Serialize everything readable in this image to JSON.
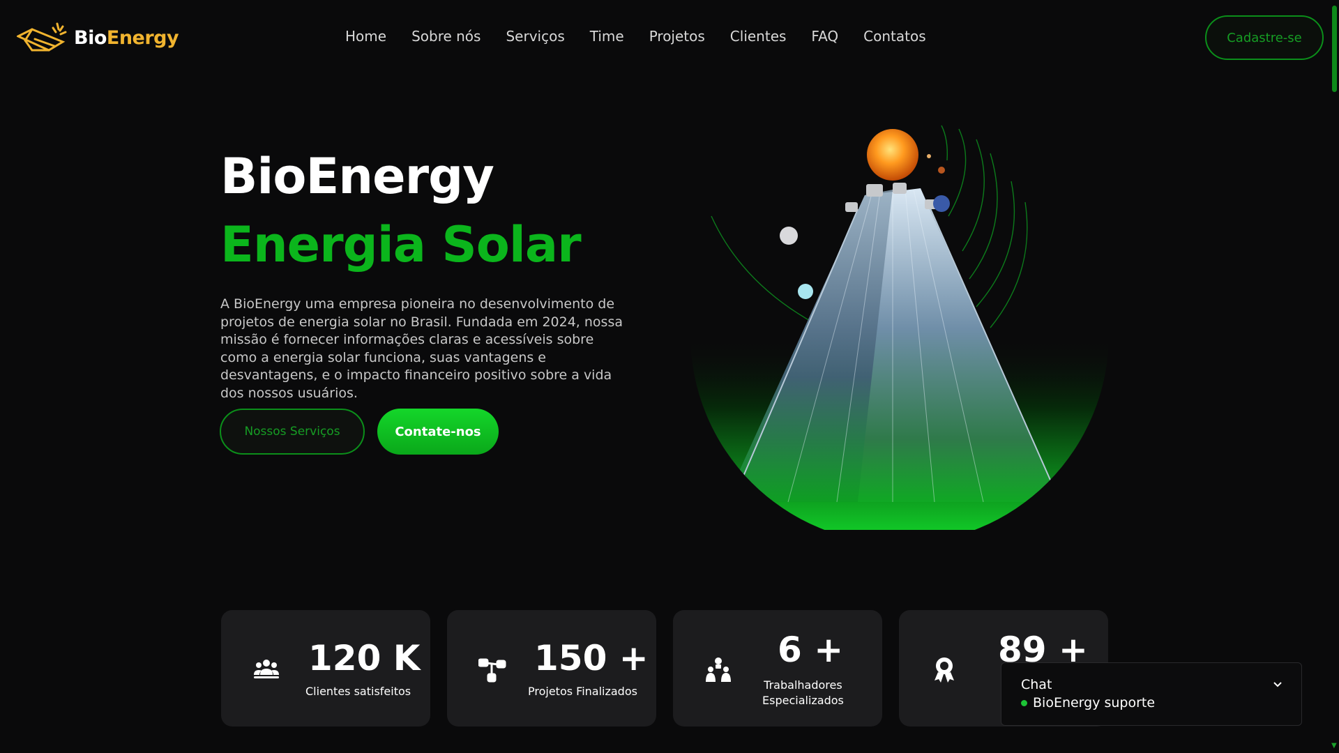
{
  "header": {
    "logo": {
      "bio": "Bio",
      "energy": "Energy"
    },
    "nav": [
      "Home",
      "Sobre nós",
      "Serviços",
      "Time",
      "Projetos",
      "Clientes",
      "FAQ",
      "Contatos"
    ],
    "signup_label": "Cadastre-se"
  },
  "hero": {
    "title": "BioEnergy",
    "subtitle": "Energia Solar",
    "description": "A BioEnergy uma empresa pioneira no desenvolvimento de projetos de energia solar no Brasil. Fundada em 2024, nossa missão é fornecer informações claras e acessíveis sobre como a energia solar funciona, suas vantagens e desvantagens, e o impacto financeiro positivo sobre a vida dos nossos usuários.",
    "btn_services": "Nossos Serviços",
    "btn_contact": "Contate-nos"
  },
  "stats": [
    {
      "icon": "users-icon",
      "value": "120 K",
      "label": "Clientes satisfeitos"
    },
    {
      "icon": "project-nodes-icon",
      "value": "150 +",
      "label": "Projetos Finalizados"
    },
    {
      "icon": "workers-icon",
      "value": "6 +",
      "label_line1": "Trabalhadores",
      "label_line2": "Especializados"
    },
    {
      "icon": "award-icon",
      "value": "89 +",
      "label": ""
    }
  ],
  "chat": {
    "title": "Chat",
    "status": "BioEnergy suporte"
  },
  "colors": {
    "background": "#0a0a0b",
    "accent_green": "#0bb51c",
    "logo_gold": "#f1b42f",
    "card_bg": "#1c1c1e"
  }
}
